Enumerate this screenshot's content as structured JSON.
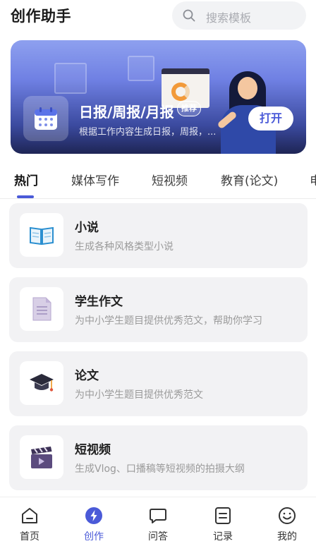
{
  "header": {
    "title": "创作助手",
    "search_placeholder": "搜索模板"
  },
  "banner": {
    "title": "日报/周报/月报",
    "badge": "推荐",
    "description": "根据工作内容生成日报，周报，...",
    "open_button": "打开",
    "icon": "calendar-icon"
  },
  "tabs": [
    {
      "label": "热门",
      "active": true
    },
    {
      "label": "媒体写作",
      "active": false
    },
    {
      "label": "短视频",
      "active": false
    },
    {
      "label": "教育(论文)",
      "active": false
    },
    {
      "label": "电",
      "active": false
    }
  ],
  "cards": [
    {
      "title": "小说",
      "description": "生成各种风格类型小说",
      "icon": "open-book-icon"
    },
    {
      "title": "学生作文",
      "description": "为中小学生题目提供优秀范文，帮助你学习",
      "icon": "document-icon"
    },
    {
      "title": "论文",
      "description": "为中小学生题目提供优秀范文",
      "icon": "graduation-cap-icon"
    },
    {
      "title": "短视频",
      "description": "生成Vlog、口播稿等短视频的拍摄大纲",
      "icon": "clapperboard-icon"
    }
  ],
  "bottom_nav": [
    {
      "label": "首页",
      "icon": "home-icon",
      "active": false
    },
    {
      "label": "创作",
      "icon": "lightning-icon",
      "active": true
    },
    {
      "label": "问答",
      "icon": "chat-bubble-icon",
      "active": false
    },
    {
      "label": "记录",
      "icon": "record-list-icon",
      "active": false
    },
    {
      "label": "我的",
      "icon": "smiley-profile-icon",
      "active": false
    }
  ],
  "colors": {
    "accent": "#4a5ad8",
    "card_background": "#f2f2f4",
    "banner_top": "#8ea0ef",
    "banner_bottom": "#1e2555"
  }
}
